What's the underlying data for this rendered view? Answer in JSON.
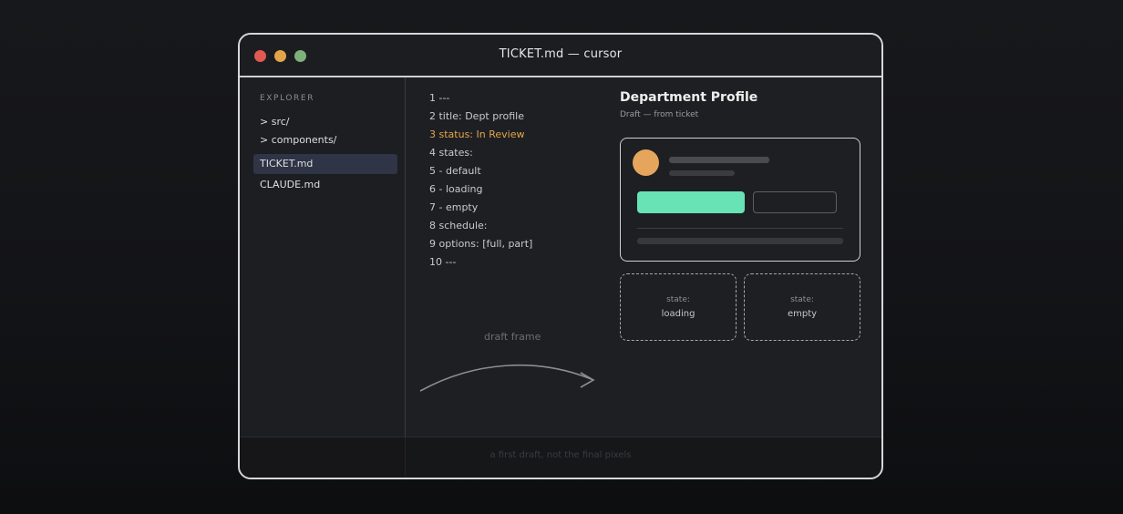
{
  "window": {
    "title": "TICKET.md — cursor"
  },
  "sidebar": {
    "section_label": "EXPLORER",
    "folders": [
      "> src/",
      "> components/"
    ],
    "files": [
      {
        "label": "TICKET.md",
        "active": true
      },
      {
        "label": "CLAUDE.md",
        "active": false
      }
    ]
  },
  "editor": {
    "lines": [
      "1 ---",
      "2 title: Dept profile",
      "3 status: In Review",
      "4 states:",
      "5 - default",
      "6 - loading",
      "7 - empty",
      "8 schedule:",
      "9 options: [full, part]",
      "10 ---"
    ],
    "highlighted_line": 3,
    "annotation": "draft frame"
  },
  "preview": {
    "title": "Department Profile",
    "subtitle": "Draft — from ticket",
    "states": [
      {
        "key": "state:",
        "value": "loading"
      },
      {
        "key": "state:",
        "value": "empty"
      }
    ]
  },
  "footer": {
    "caption": "a first draft, not the final pixels"
  },
  "colors": {
    "accent_primary": "#67e3b6",
    "avatar": "#e6a55c",
    "highlight_line": "#e3a54a",
    "traffic_red": "#e05a52",
    "traffic_yellow": "#e3a54a",
    "traffic_green": "#7fb07a"
  }
}
